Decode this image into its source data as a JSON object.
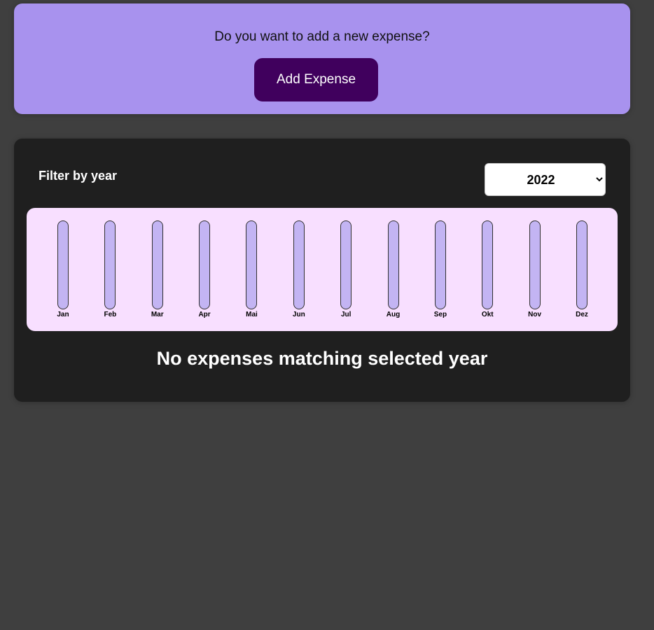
{
  "new_expense": {
    "prompt": "Do you want to add a new expense?",
    "add_button_label": "Add Expense"
  },
  "filter": {
    "label": "Filter by year",
    "selected_year": "2022"
  },
  "chart_data": {
    "type": "bar",
    "categories": [
      "Jan",
      "Feb",
      "Mar",
      "Apr",
      "Mai",
      "Jun",
      "Jul",
      "Aug",
      "Sep",
      "Okt",
      "Nov",
      "Dez"
    ],
    "values": [
      0,
      0,
      0,
      0,
      0,
      0,
      0,
      0,
      0,
      0,
      0,
      0
    ]
  },
  "empty_message": "No expenses matching selected year",
  "colors": {
    "page_bg": "#3f3f3f",
    "form_bg": "#a892ee",
    "button_bg": "#40005d",
    "panel_bg": "#1f1f1f",
    "chart_bg": "#f8dfff",
    "bar_track": "#c3b4f3"
  }
}
